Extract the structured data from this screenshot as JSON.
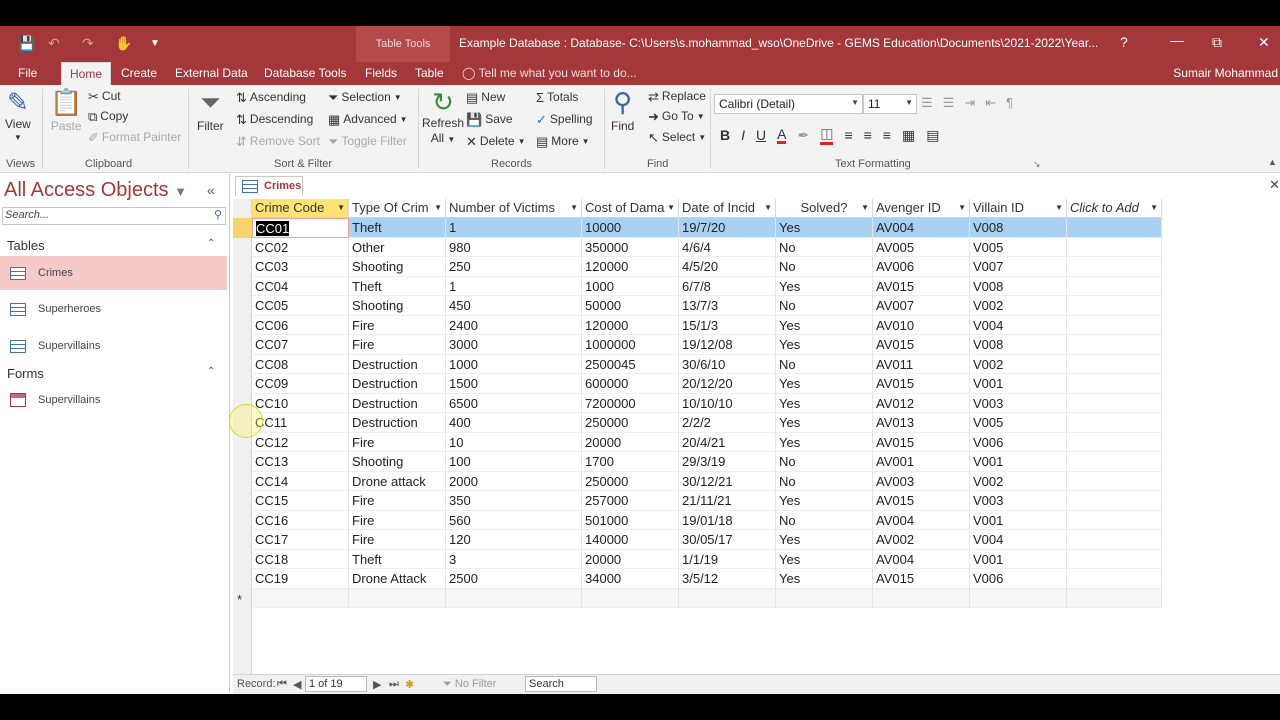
{
  "titlebar": {
    "context_tab": "Table Tools",
    "window_title": "Example Database : Database- C:\\Users\\s.mohammad_wso\\OneDrive - GEMS Education\\Documents\\2021-2022\\Year...",
    "help": "?",
    "restore": "⧉",
    "close": "✕"
  },
  "tabs": [
    "File",
    "Home",
    "Create",
    "External Data",
    "Database Tools",
    "Fields",
    "Table"
  ],
  "tell_me": "Tell me what you want to do...",
  "user_name": "Sumair Mohammad",
  "ribbon": {
    "views": {
      "view": "View",
      "label": "Views"
    },
    "clipboard": {
      "paste": "Paste",
      "cut": "Cut",
      "copy": "Copy",
      "format_painter": "Format Painter",
      "label": "Clipboard"
    },
    "sort_filter": {
      "filter": "Filter",
      "ascending": "Ascending",
      "descending": "Descending",
      "remove_sort": "Remove Sort",
      "selection": "Selection",
      "advanced": "Advanced",
      "toggle_filter": "Toggle Filter",
      "label": "Sort & Filter"
    },
    "records": {
      "refresh": "Refresh",
      "refresh_all": "All",
      "new": "New",
      "save": "Save",
      "delete": "Delete",
      "totals": "Totals",
      "spelling": "Spelling",
      "more": "More",
      "label": "Records"
    },
    "find": {
      "find": "Find",
      "replace": "Replace",
      "goto": "Go To",
      "select": "Select",
      "label": "Find"
    },
    "text_formatting": {
      "font": "Calibri (Detail)",
      "size": "11",
      "bold": "B",
      "italic": "I",
      "underline": "U",
      "label": "Text Formatting"
    }
  },
  "nav": {
    "title": "All Access Objects",
    "search_placeholder": "Search...",
    "sections": [
      {
        "name": "Tables",
        "items": [
          "Crimes",
          "Superheroes",
          "Supervillains"
        ]
      },
      {
        "name": "Forms",
        "items": [
          "Supervillains"
        ]
      }
    ]
  },
  "document": {
    "tab": "Crimes",
    "columns": [
      "Crime Code",
      "Type Of Crim",
      "Number of Victims",
      "Cost of Dama",
      "Date of Incid",
      "Solved?",
      "Avenger ID",
      "Villain ID",
      "Click to Add"
    ],
    "rows": [
      [
        "CC01",
        "Theft",
        "1",
        "10000",
        "19/7/20",
        "Yes",
        "AV004",
        "V008"
      ],
      [
        "CC02",
        "Other",
        "980",
        "350000",
        "4/6/4",
        "No",
        "AV005",
        "V005"
      ],
      [
        "CC03",
        "Shooting",
        "250",
        "120000",
        "4/5/20",
        "No",
        "AV006",
        "V007"
      ],
      [
        "CC04",
        "Theft",
        "1",
        "1000",
        "6/7/8",
        "Yes",
        "AV015",
        "V008"
      ],
      [
        "CC05",
        "Shooting",
        "450",
        "50000",
        "13/7/3",
        "No",
        "AV007",
        "V002"
      ],
      [
        "CC06",
        "Fire",
        "2400",
        "120000",
        "15/1/3",
        "Yes",
        "AV010",
        "V004"
      ],
      [
        "CC07",
        "Fire",
        "3000",
        "1000000",
        "19/12/08",
        "Yes",
        "AV015",
        "V008"
      ],
      [
        "CC08",
        "Destruction",
        "1000",
        "2500045",
        "30/6/10",
        "No",
        "AV011",
        "V002"
      ],
      [
        "CC09",
        "Destruction",
        "1500",
        "600000",
        "20/12/20",
        "Yes",
        "AV015",
        "V001"
      ],
      [
        "CC10",
        "Destruction",
        "6500",
        "7200000",
        "10/10/10",
        "Yes",
        "AV012",
        "V003"
      ],
      [
        "CC11",
        "Destruction",
        "400",
        "250000",
        "2/2/2",
        "Yes",
        "AV013",
        "V005"
      ],
      [
        "CC12",
        "Fire",
        "10",
        "20000",
        "20/4/21",
        "Yes",
        "AV015",
        "V006"
      ],
      [
        "CC13",
        "Shooting",
        "100",
        "1700",
        "29/3/19",
        "No",
        "AV001",
        "V001"
      ],
      [
        "CC14",
        "Drone attack",
        "2000",
        "250000",
        "30/12/21",
        "No",
        "AV003",
        "V002"
      ],
      [
        "CC15",
        "Fire",
        "350",
        "257000",
        "21/11/21",
        "Yes",
        "AV015",
        "V003"
      ],
      [
        "CC16",
        "Fire",
        "560",
        "501000",
        "19/01/18",
        "No",
        "AV004",
        "V001"
      ],
      [
        "CC17",
        "Fire",
        "120",
        "140000",
        "30/05/17",
        "Yes",
        "AV002",
        "V004"
      ],
      [
        "CC18",
        "Theft",
        "3",
        "20000",
        "1/1/19",
        "Yes",
        "AV004",
        "V001"
      ],
      [
        "CC19",
        "Drone Attack",
        "2500",
        "34000",
        "3/5/12",
        "Yes",
        "AV015",
        "V006"
      ]
    ],
    "new_row_marker": "*"
  },
  "statusbar": {
    "record_label": "Record:",
    "position": "1 of 19",
    "no_filter": "No Filter",
    "search": "Search"
  },
  "colors": {
    "accent": "#a4373a",
    "selected_row": "#a9d1f4",
    "active_header": "#fce372",
    "nav_selected": "#f7caca"
  }
}
